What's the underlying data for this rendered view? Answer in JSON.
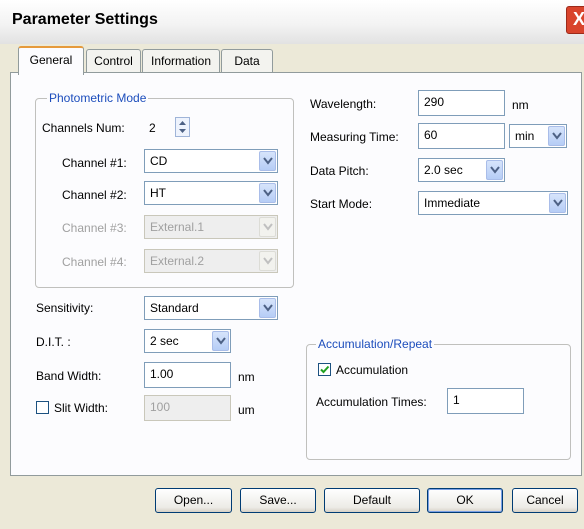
{
  "window": {
    "title": "Parameter Settings",
    "close": "X"
  },
  "tabs": [
    {
      "label": "General"
    },
    {
      "label": "Control"
    },
    {
      "label": "Information"
    },
    {
      "label": "Data"
    }
  ],
  "photometric": {
    "legend": "Photometric Mode",
    "channels_label": "Channels Num:",
    "channels_value": "2",
    "channel1_label": "Channel #1:",
    "channel1_value": "CD",
    "channel2_label": "Channel #2:",
    "channel2_value": "HT",
    "channel3_label": "Channel #3:",
    "channel3_value": "External.1",
    "channel4_label": "Channel #4:",
    "channel4_value": "External.2"
  },
  "sensitivity": {
    "label": "Sensitivity:",
    "value": "Standard"
  },
  "dit": {
    "label": "D.I.T. :",
    "value": "2 sec"
  },
  "band_width": {
    "label": "Band Width:",
    "value": "1.00",
    "unit": "nm"
  },
  "slit_width": {
    "label": "Slit Width:",
    "value": "100",
    "unit": "um",
    "checked": false
  },
  "wavelength": {
    "label": "Wavelength:",
    "value": "290",
    "unit": "nm"
  },
  "measuring_time": {
    "label": "Measuring Time:",
    "value": "60",
    "unit": "min"
  },
  "data_pitch": {
    "label": "Data Pitch:",
    "value": "2.0 sec"
  },
  "start_mode": {
    "label": "Start Mode:",
    "value": "Immediate"
  },
  "accumulation": {
    "legend": "Accumulation/Repeat",
    "checkbox_label": "Accumulation",
    "checked": true,
    "times_label": "Accumulation Times:",
    "times_value": "1"
  },
  "buttons": {
    "open": "Open...",
    "save": "Save...",
    "default": "Default",
    "ok": "OK",
    "cancel": "Cancel"
  }
}
